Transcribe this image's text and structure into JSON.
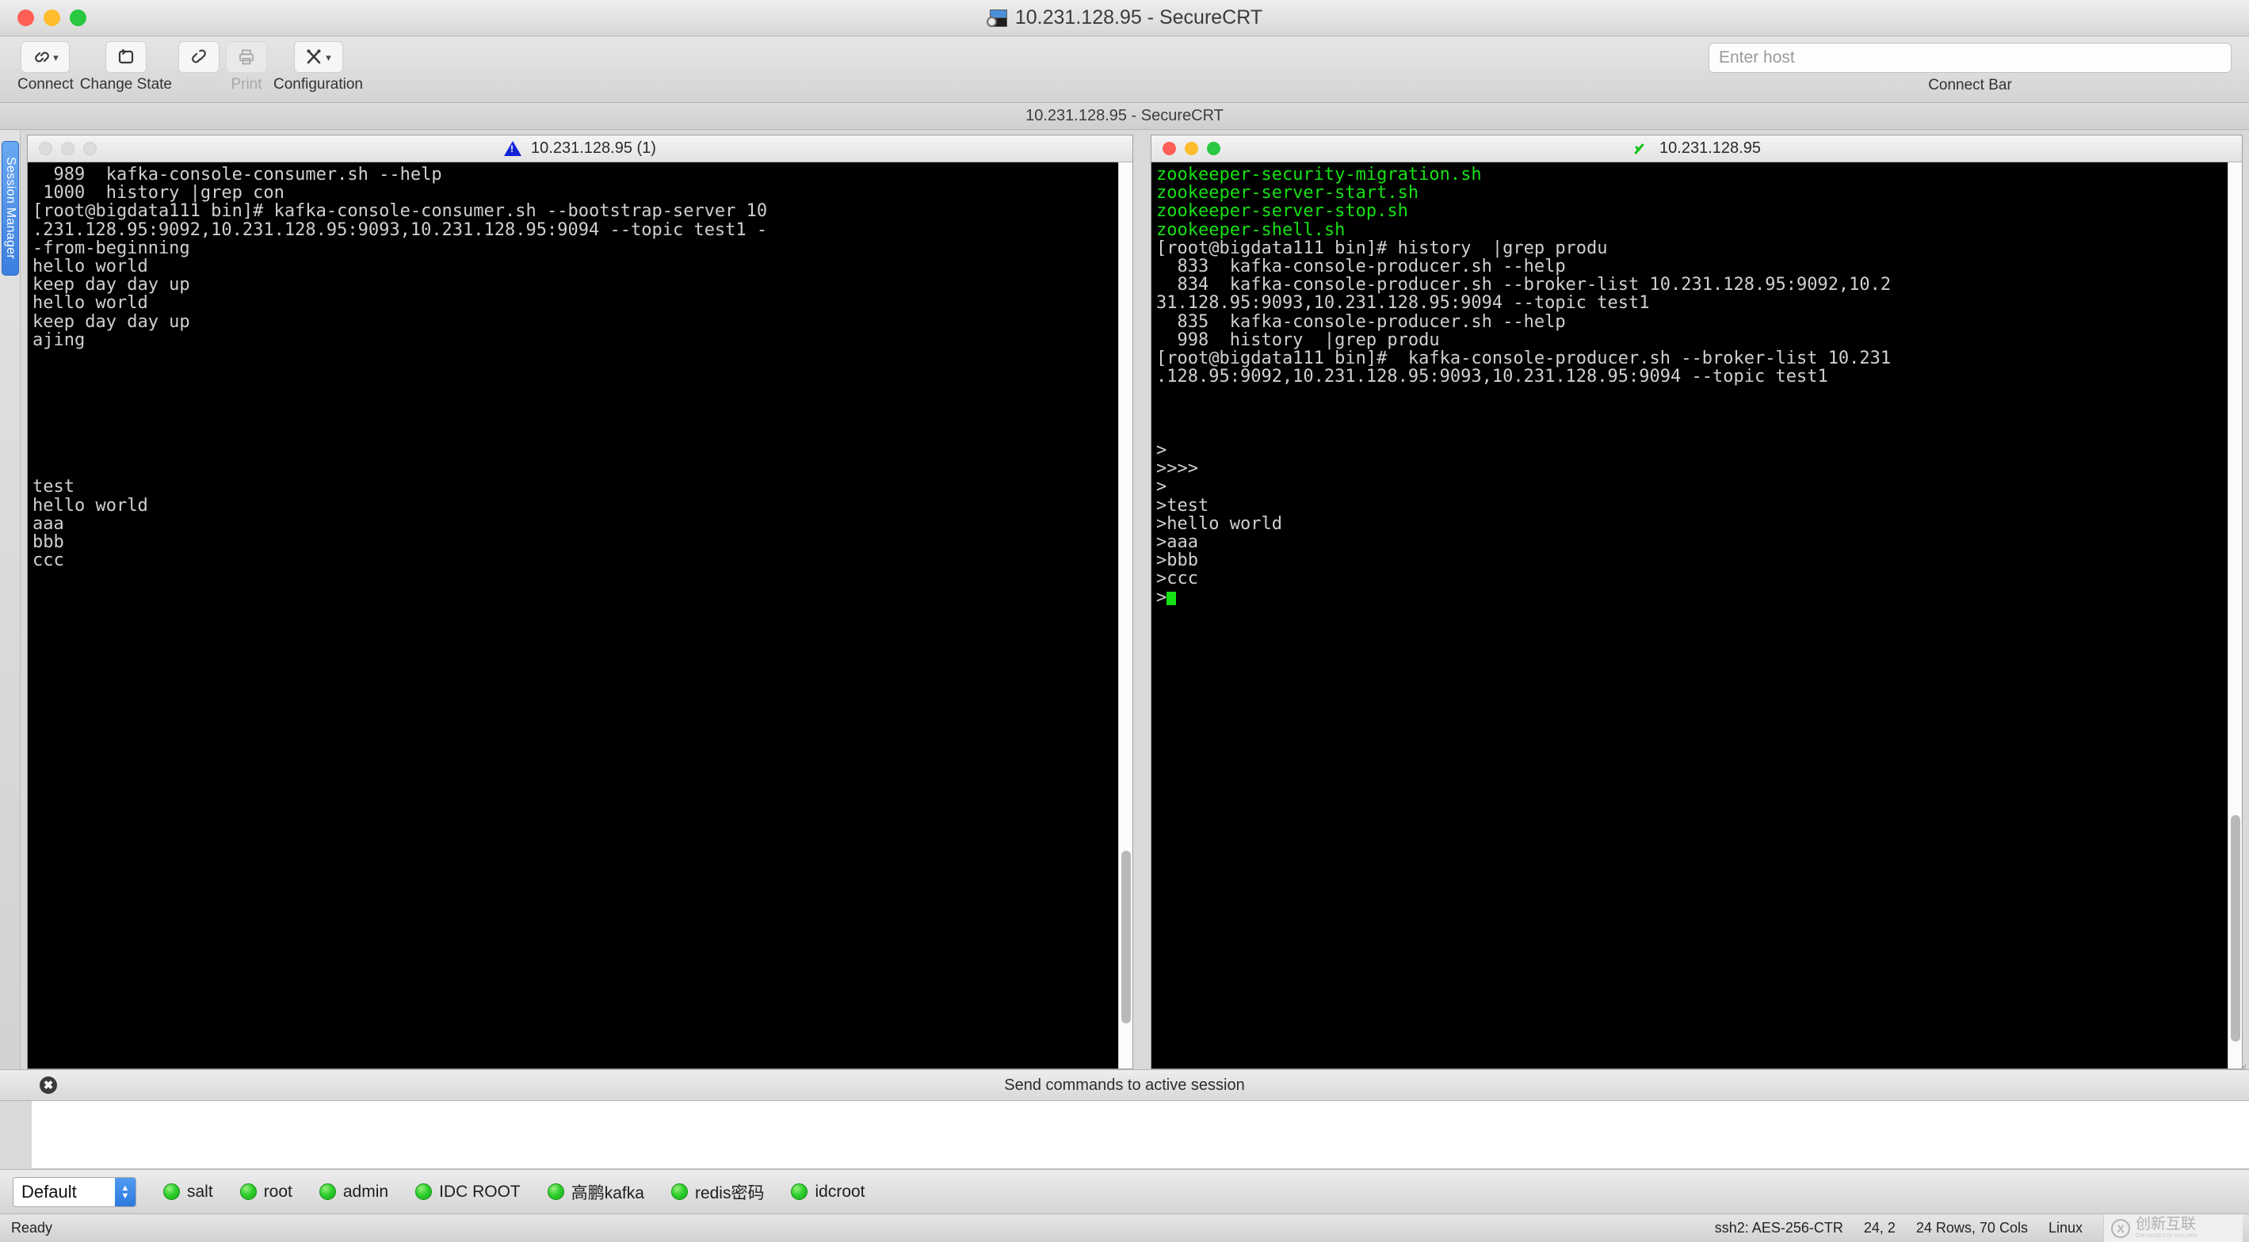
{
  "window": {
    "title": "10.231.128.95 - SecureCRT",
    "app_icon": "securecrt-icon"
  },
  "toolbar": {
    "items": [
      {
        "label": "Connect",
        "icon": "link-icon",
        "has_caret": true,
        "disabled": false
      },
      {
        "label": "Change State",
        "icon": "repeat-icon",
        "has_caret": false,
        "disabled": false
      },
      {
        "label": "",
        "icon": "disconnect-icon",
        "has_caret": false,
        "disabled": false
      },
      {
        "label": "Print",
        "icon": "printer-icon",
        "has_caret": false,
        "disabled": true
      },
      {
        "label": "Configuration",
        "icon": "tools-icon",
        "has_caret": true,
        "disabled": false
      }
    ],
    "connect_bar": {
      "label": "Connect Bar",
      "host_placeholder": "Enter host",
      "host_value": ""
    }
  },
  "tabstrip": {
    "active_tab": "10.231.128.95 - SecureCRT"
  },
  "session_manager": {
    "label": "Session Manager"
  },
  "panes": {
    "left": {
      "title": "10.231.128.95 (1)",
      "status_icon": "warning-icon",
      "active": false,
      "lines": [
        {
          "text": "  989  kafka-console-consumer.sh --help",
          "color": "default"
        },
        {
          "text": " 1000  history |grep con",
          "color": "default"
        },
        {
          "text": "[root@bigdata111 bin]# kafka-console-consumer.sh --bootstrap-server 10",
          "color": "default"
        },
        {
          "text": ".231.128.95:9092,10.231.128.95:9093,10.231.128.95:9094 --topic test1 -",
          "color": "default"
        },
        {
          "text": "-from-beginning",
          "color": "default"
        },
        {
          "text": "hello world",
          "color": "default"
        },
        {
          "text": "keep day day up",
          "color": "default"
        },
        {
          "text": "hello world",
          "color": "default"
        },
        {
          "text": "keep day day up",
          "color": "default"
        },
        {
          "text": "ajing",
          "color": "default"
        },
        {
          "text": "",
          "color": "default"
        },
        {
          "text": "",
          "color": "default"
        },
        {
          "text": "",
          "color": "default"
        },
        {
          "text": "",
          "color": "default"
        },
        {
          "text": "",
          "color": "default"
        },
        {
          "text": "",
          "color": "default"
        },
        {
          "text": "",
          "color": "default"
        },
        {
          "text": "test",
          "color": "default"
        },
        {
          "text": "hello world",
          "color": "default"
        },
        {
          "text": "aaa",
          "color": "default"
        },
        {
          "text": "bbb",
          "color": "default"
        },
        {
          "text": "ccc",
          "color": "default"
        }
      ]
    },
    "right": {
      "title": "10.231.128.95",
      "status_icon": "check-icon",
      "active": true,
      "lines": [
        {
          "text": "zookeeper-security-migration.sh",
          "color": "green"
        },
        {
          "text": "zookeeper-server-start.sh",
          "color": "green"
        },
        {
          "text": "zookeeper-server-stop.sh",
          "color": "green"
        },
        {
          "text": "zookeeper-shell.sh",
          "color": "green"
        },
        {
          "text": "[root@bigdata111 bin]# history  |grep produ",
          "color": "default"
        },
        {
          "text": "  833  kafka-console-producer.sh --help",
          "color": "default"
        },
        {
          "text": "  834  kafka-console-producer.sh --broker-list 10.231.128.95:9092,10.2",
          "color": "default"
        },
        {
          "text": "31.128.95:9093,10.231.128.95:9094 --topic test1",
          "color": "default"
        },
        {
          "text": "  835  kafka-console-producer.sh --help",
          "color": "default"
        },
        {
          "text": "  998  history  |grep produ",
          "color": "default"
        },
        {
          "text": "[root@bigdata111 bin]#  kafka-console-producer.sh --broker-list 10.231",
          "color": "default"
        },
        {
          "text": ".128.95:9092,10.231.128.95:9093,10.231.128.95:9094 --topic test1",
          "color": "default"
        },
        {
          "text": "",
          "color": "default"
        },
        {
          "text": "",
          "color": "default"
        },
        {
          "text": "",
          "color": "default"
        },
        {
          "text": ">",
          "color": "default"
        },
        {
          "text": ">>>>",
          "color": "default"
        },
        {
          "text": ">",
          "color": "default"
        },
        {
          "text": ">test",
          "color": "default"
        },
        {
          "text": ">hello world",
          "color": "default"
        },
        {
          "text": ">aaa",
          "color": "default"
        },
        {
          "text": ">bbb",
          "color": "default"
        },
        {
          "text": ">ccc",
          "color": "default"
        }
      ],
      "prompt": ">",
      "cursor": "block-cursor"
    }
  },
  "send_commands": {
    "label": "Send commands to active session",
    "close_label": "✖",
    "input_value": ""
  },
  "button_bar": {
    "session_group": "Default",
    "buttons": [
      {
        "label": "salt",
        "led": "green"
      },
      {
        "label": "root",
        "led": "green"
      },
      {
        "label": "admin",
        "led": "green"
      },
      {
        "label": "IDC ROOT",
        "led": "green"
      },
      {
        "label": "高鹏kafka",
        "led": "green"
      },
      {
        "label": "redis密码",
        "led": "green"
      },
      {
        "label": "idcroot",
        "led": "green"
      }
    ]
  },
  "status_bar": {
    "left": "Ready",
    "cipher": "ssh2: AES-256-CTR",
    "cursor_pos": "24, 2",
    "dimensions": "24 Rows, 70 Cols",
    "os": "Linux",
    "watermark_text": "创新互联",
    "watermark_sub": "CHUANGXIN HULIAN",
    "watermark_mark": "X"
  },
  "colors": {
    "terminal_bg": "#000000",
    "terminal_fg": "#d0d0d0",
    "terminal_green": "#17e017",
    "accent_blue": "#3b7fe0",
    "warning_blue": "#1324d6",
    "led_green": "#2fd02f"
  }
}
